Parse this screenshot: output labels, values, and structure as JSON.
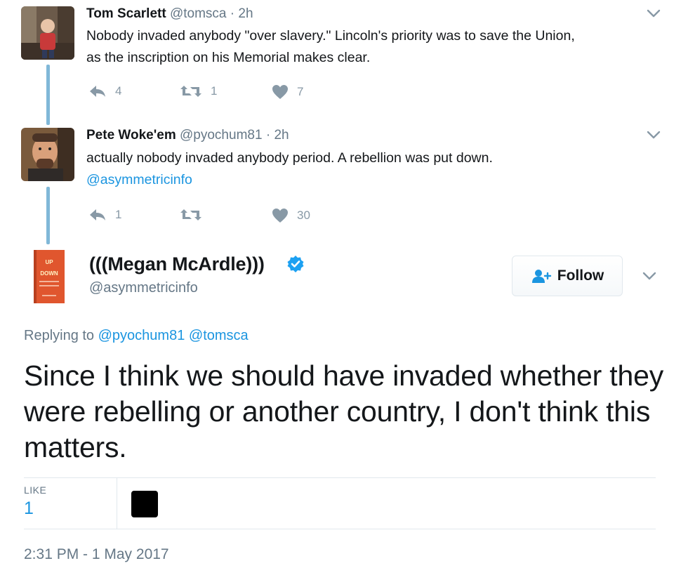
{
  "thread": [
    {
      "name": "Tom Scarlett",
      "handle": "@tomsca",
      "sep": "·",
      "time": "2h",
      "text_lines": [
        "Nobody invaded anybody \"over slavery.\" Lincoln's priority was to save the Union,",
        "as the inscription on his Memorial makes clear."
      ],
      "replies": "4",
      "retweets": "1",
      "likes": "7"
    },
    {
      "name": "Pete Woke'em",
      "handle": "@pyochum81",
      "sep": "·",
      "time": "2h",
      "text_lines": [
        "actually nobody invaded anybody period. A rebellion was put down."
      ],
      "mention": "@asymmetricinfo",
      "replies": "1",
      "retweets": "",
      "likes": "30"
    }
  ],
  "main": {
    "name": "(((Megan McArdle)))",
    "handle": "@asymmetricinfo",
    "follow_label": "Follow",
    "replying_prefix": "Replying to",
    "replying_to": [
      "@pyochum81",
      "@tomsca"
    ],
    "text": "Since I think we should have invaded whether they were rebelling or another country, I don't think this matters.",
    "like_label": "LIKE",
    "like_count": "1",
    "timestamp": "2:31 PM - 1 May 2017",
    "avatar_book": {
      "line1": "UP",
      "line2": "DOWN"
    }
  },
  "colors": {
    "link": "#1b95e0",
    "muted": "#657786",
    "action": "#8899a6",
    "thread_line": "#80b8d8",
    "verified": "#1da1f2"
  },
  "icons": [
    "reply-icon",
    "retweet-icon",
    "heart-icon",
    "chevron-down-icon",
    "verified-badge-icon",
    "follow-person-icon"
  ]
}
